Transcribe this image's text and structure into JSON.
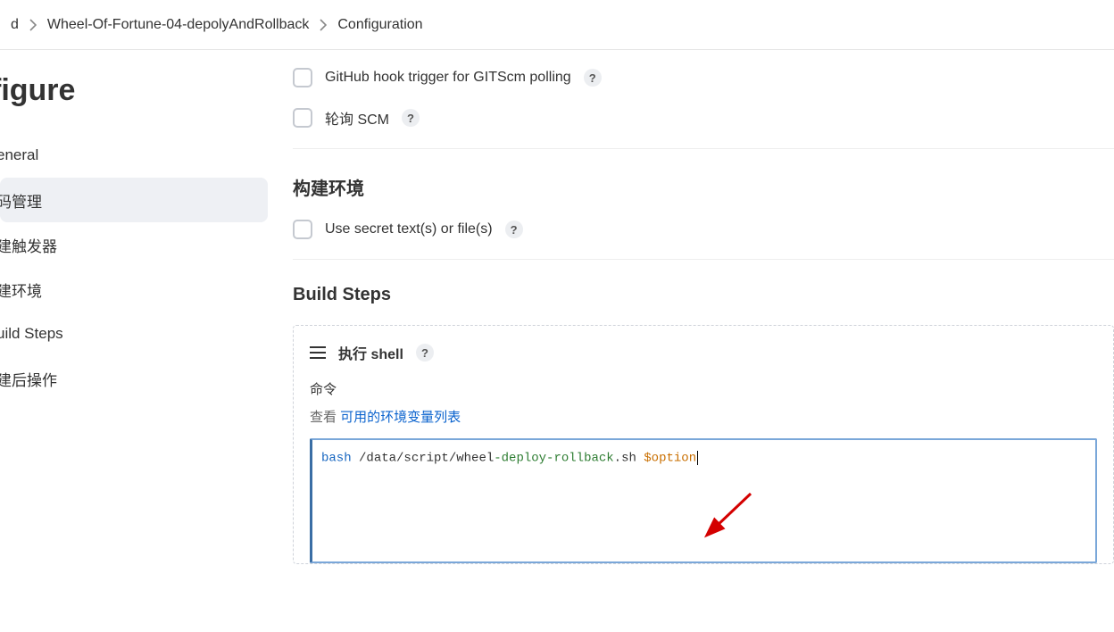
{
  "breadcrumb": {
    "item0_truncated": "d",
    "item1": "Wheel-Of-Fortune-04-depolyAndRollback",
    "item2": "Configuration"
  },
  "page_title": "figure",
  "sidebar": {
    "items": [
      {
        "label": "eneral"
      },
      {
        "label": "码管理"
      },
      {
        "label": "建触发器"
      },
      {
        "label": "建环境"
      },
      {
        "label": "uild Steps"
      },
      {
        "label": "建后操作"
      }
    ],
    "active_index": 1
  },
  "triggers": {
    "github_label": "GitHub hook trigger for GITScm polling",
    "poll_label": "轮询 SCM"
  },
  "sections": {
    "build_env": "构建环境",
    "secret_label": "Use secret text(s) or file(s)",
    "build_steps": "Build Steps"
  },
  "shell_step": {
    "title": "执行 shell",
    "command_label": "命令",
    "env_prefix": "查看 ",
    "env_link": "可用的环境变量列表",
    "code": {
      "cmd": "bash",
      "space1": " ",
      "path1": "/data/script/wheel",
      "dash1": "-deploy-rollback",
      "tail": ".sh ",
      "var": "$option"
    },
    "raw_command": "bash /data/script/wheel-deploy-rollback.sh $option"
  }
}
